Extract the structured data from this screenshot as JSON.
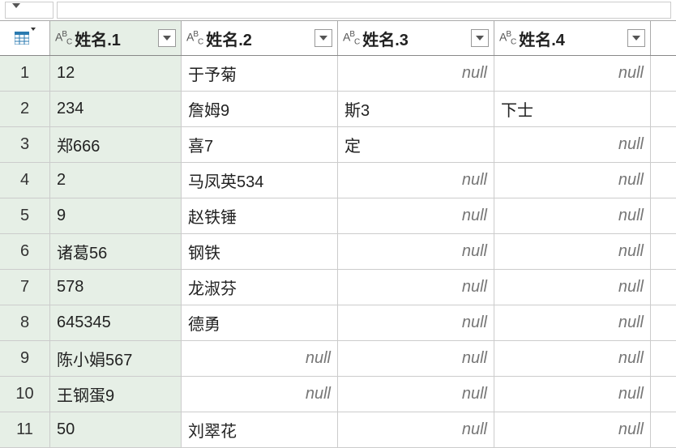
{
  "null_text": "null",
  "columns": [
    {
      "label": "姓名.1"
    },
    {
      "label": "姓名.2"
    },
    {
      "label": "姓名.3"
    },
    {
      "label": "姓名.4"
    }
  ],
  "rows": [
    {
      "n": "1",
      "c1": "12",
      "c2": "于予菊",
      "c3": null,
      "c4": null
    },
    {
      "n": "2",
      "c1": "234",
      "c2": "詹姆9",
      "c3": "斯3",
      "c4": "下士"
    },
    {
      "n": "3",
      "c1": "郑666",
      "c2": "喜7",
      "c3": "定",
      "c4": null
    },
    {
      "n": "4",
      "c1": "2",
      "c2": "马凤英534",
      "c3": null,
      "c4": null
    },
    {
      "n": "5",
      "c1": "9",
      "c2": "赵铁锤",
      "c3": null,
      "c4": null
    },
    {
      "n": "6",
      "c1": "诸葛56",
      "c2": "钢铁",
      "c3": null,
      "c4": null
    },
    {
      "n": "7",
      "c1": "578",
      "c2": "龙淑芬",
      "c3": null,
      "c4": null
    },
    {
      "n": "8",
      "c1": "645345",
      "c2": "德勇",
      "c3": null,
      "c4": null
    },
    {
      "n": "9",
      "c1": "陈小娟567",
      "c2": null,
      "c3": null,
      "c4": null
    },
    {
      "n": "10",
      "c1": "王钢蛋9",
      "c2": null,
      "c3": null,
      "c4": null
    },
    {
      "n": "11",
      "c1": "50",
      "c2": "刘翠花",
      "c3": null,
      "c4": null
    }
  ]
}
